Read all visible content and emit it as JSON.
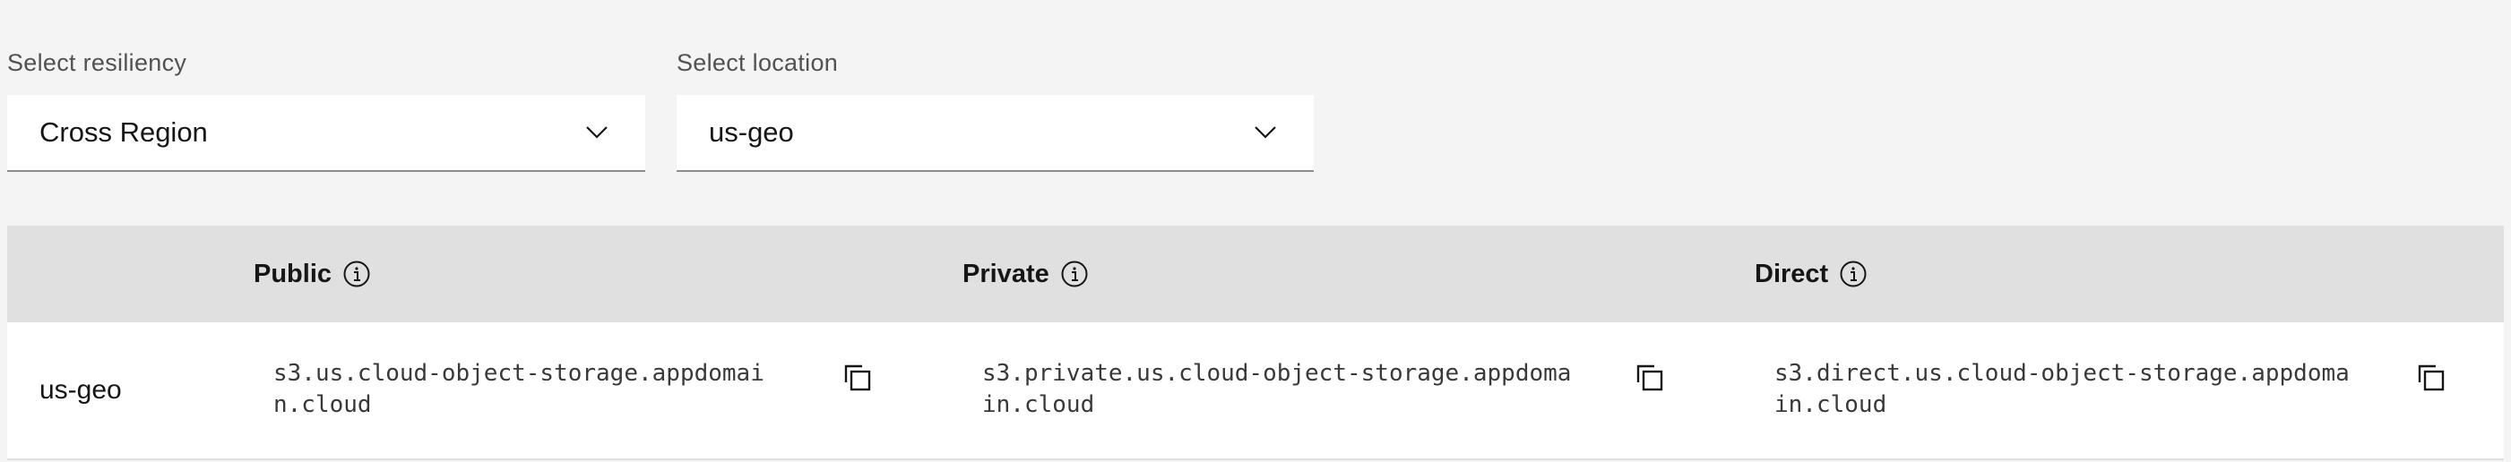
{
  "resiliency": {
    "label": "Select resiliency",
    "value": "Cross Region"
  },
  "location": {
    "label": "Select location",
    "value": "us-geo"
  },
  "table": {
    "headers": {
      "public": "Public",
      "private": "Private",
      "direct": "Direct"
    },
    "rows": [
      {
        "location": "us-geo",
        "public": "s3.us.cloud-object-storage.appdomain.cloud",
        "private": "s3.private.us.cloud-object-storage.appdomain.cloud",
        "direct": "s3.direct.us.cloud-object-storage.appdomain.cloud"
      }
    ]
  },
  "icons": {
    "dropdown": "chevron-down-icon",
    "info": "info-icon",
    "copy": "copy-icon"
  },
  "colors": {
    "page_background": "#f4f4f4",
    "header_background": "#e0e0e0",
    "field_background": "#ffffff",
    "text_primary": "#161616",
    "label_text": "#525252"
  }
}
